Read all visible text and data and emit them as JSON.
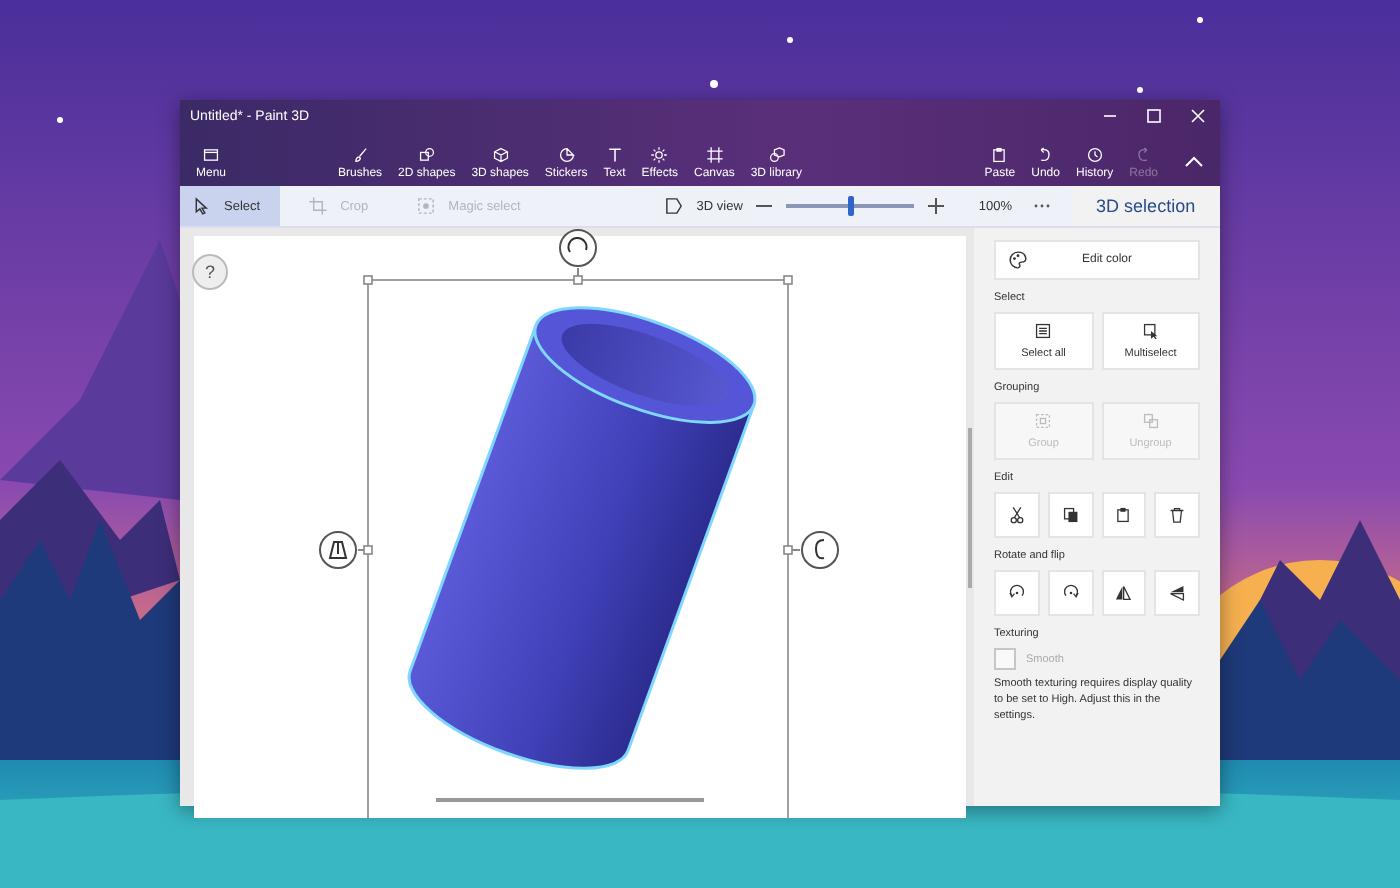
{
  "window": {
    "title": "Untitled* - Paint 3D"
  },
  "ribbon": {
    "tools": [
      {
        "kind": "menu",
        "label": "Menu",
        "disabled": false
      },
      {
        "kind": "brush",
        "label": "Brushes",
        "disabled": false
      },
      {
        "kind": "shapes2d",
        "label": "2D shapes",
        "disabled": false
      },
      {
        "kind": "shapes3d",
        "label": "3D shapes",
        "disabled": false
      },
      {
        "kind": "sticker",
        "label": "Stickers",
        "disabled": false
      },
      {
        "kind": "text",
        "label": "Text",
        "disabled": false
      },
      {
        "kind": "effects",
        "label": "Effects",
        "disabled": false
      },
      {
        "kind": "canvas",
        "label": "Canvas",
        "disabled": false
      },
      {
        "kind": "library",
        "label": "3D library",
        "disabled": false
      }
    ],
    "actions": [
      {
        "kind": "paste",
        "label": "Paste",
        "disabled": false
      },
      {
        "kind": "undo",
        "label": "Undo",
        "disabled": false
      },
      {
        "kind": "history",
        "label": "History",
        "disabled": false
      },
      {
        "kind": "redo",
        "label": "Redo",
        "disabled": true
      }
    ]
  },
  "toolbar": {
    "tools": [
      {
        "kind": "select",
        "label": "Select",
        "selected": true,
        "disabled": false
      },
      {
        "kind": "crop",
        "label": "Crop",
        "selected": false,
        "disabled": true
      },
      {
        "kind": "magic",
        "label": "Magic select",
        "selected": false,
        "disabled": true
      }
    ],
    "view_3d": {
      "label": "3D view"
    },
    "zoom": {
      "level": 0.5,
      "reading": "100%"
    }
  },
  "panel": {
    "title": "3D selection",
    "sections": [
      {
        "kind": "wide",
        "buttons": [
          {
            "kind": "palette",
            "label": "Edit color",
            "disabled": false
          }
        ]
      },
      {
        "kind": "tiles",
        "heading": "Select",
        "buttons": [
          {
            "kind": "select-all",
            "label": "Select all",
            "disabled": false
          },
          {
            "kind": "multiselect",
            "label": "Multiselect",
            "disabled": false
          }
        ]
      },
      {
        "kind": "tiles",
        "heading": "Grouping",
        "buttons": [
          {
            "kind": "group",
            "label": "Group",
            "disabled": true
          },
          {
            "kind": "ungroup",
            "label": "Ungroup",
            "disabled": true
          }
        ]
      },
      {
        "kind": "icons",
        "heading": "Edit",
        "buttons": [
          {
            "kind": "cut",
            "disabled": false
          },
          {
            "kind": "copy",
            "disabled": false
          },
          {
            "kind": "paste",
            "disabled": false
          },
          {
            "kind": "delete",
            "disabled": false
          }
        ]
      },
      {
        "kind": "icons",
        "heading": "Rotate and flip",
        "buttons": [
          {
            "kind": "rotate-left",
            "disabled": false
          },
          {
            "kind": "rotate-right",
            "disabled": false
          },
          {
            "kind": "flip-vertical",
            "disabled": false
          },
          {
            "kind": "flip-horizontal",
            "disabled": false
          }
        ]
      },
      {
        "kind": "checkbox",
        "heading": "Texturing",
        "label": "Smooth",
        "checked": false,
        "disabled": true,
        "note": "Smooth texturing requires display quality to be set to High. Adjust this in the settings."
      }
    ]
  },
  "canvas": {
    "help": "?"
  }
}
